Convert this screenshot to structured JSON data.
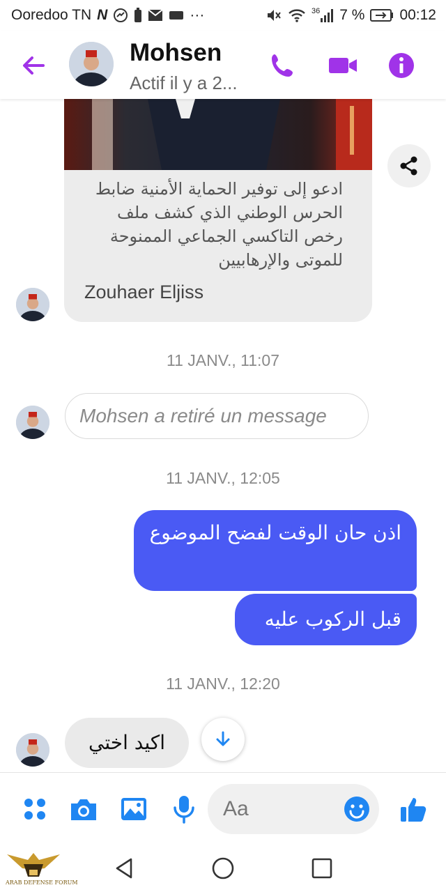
{
  "status_bar": {
    "carrier": "Ooredoo TN",
    "network": "36",
    "battery": "7 %",
    "time": "00:12"
  },
  "header": {
    "contact_name": "Mohsen",
    "contact_status": "Actif il y a 2..."
  },
  "shared_post": {
    "text": "ادعو إلى توفير الحماية الأمنية ضابط الحرس الوطني الذي كشف ملف رخص التاكسي الجماعي الممنوحة للموتى والإرهابيين",
    "author": "Zouhaer Eljiss"
  },
  "messages": {
    "ts1": "11 JANV., 11:07",
    "removed": "Mohsen a retiré un message",
    "ts2": "11 JANV., 12:05",
    "out1": "اذن حان الوقت لفضح الموضوع",
    "out2": "قبل الركوب عليه",
    "ts3": "11 JANV., 12:20",
    "in1": "اكيد اختي"
  },
  "composer": {
    "placeholder": "Aa"
  },
  "colors": {
    "accent": "#a033e8",
    "messenger_blue": "#4a5af4",
    "icon_blue": "#1f86f2"
  },
  "icons": [
    "back-arrow-icon",
    "phone-icon",
    "video-icon",
    "info-icon",
    "share-icon",
    "chevron-down-icon",
    "menu-dots-icon",
    "camera-icon",
    "image-icon",
    "mic-icon",
    "emoji-icon",
    "thumbs-up-icon",
    "nav-back-icon",
    "nav-home-icon",
    "nav-recents-icon"
  ],
  "watermark": {
    "text": "ARAB DEFENSE FORUM"
  }
}
